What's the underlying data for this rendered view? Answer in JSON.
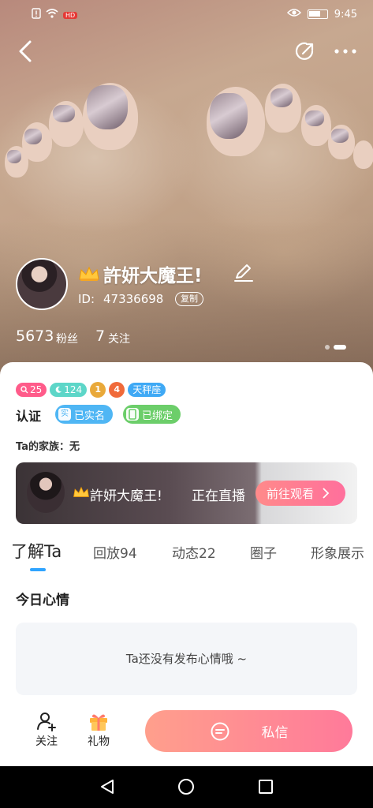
{
  "status_bar": {
    "hd_label": "HD",
    "time": "9:45"
  },
  "profile": {
    "nickname": "許妍大魔王!",
    "id_label": "ID:",
    "id_value": "47336698",
    "copy_label": "复制",
    "fans_count": "5673",
    "fans_label": "粉丝",
    "following_count": "7",
    "following_label": "关注"
  },
  "badges": {
    "level_pink": "25",
    "level_teal": "124",
    "medal_1": "1",
    "medal_2": "4",
    "zodiac": "天秤座"
  },
  "certification": {
    "label": "认证",
    "realname_icon": "实",
    "realname": "已实名",
    "bound": "已绑定"
  },
  "family": {
    "text": "Ta的家族：无"
  },
  "live": {
    "name": "許妍大魔王!",
    "status": "正在直播",
    "button": "前往观看"
  },
  "tabs": [
    {
      "label": "了解Ta"
    },
    {
      "label": "回放94"
    },
    {
      "label": "动态22"
    },
    {
      "label": "圈子"
    },
    {
      "label": "形象展示"
    }
  ],
  "mood": {
    "title": "今日心情",
    "empty_text": "Ta还没有发布心情哦 ~"
  },
  "actions": {
    "follow": "关注",
    "gift": "礼物",
    "message": "私信"
  },
  "colors": {
    "accent_blue": "#2fa4ff",
    "message_gradient_start": "#ff9f8c",
    "message_gradient_end": "#ff7a9a"
  }
}
